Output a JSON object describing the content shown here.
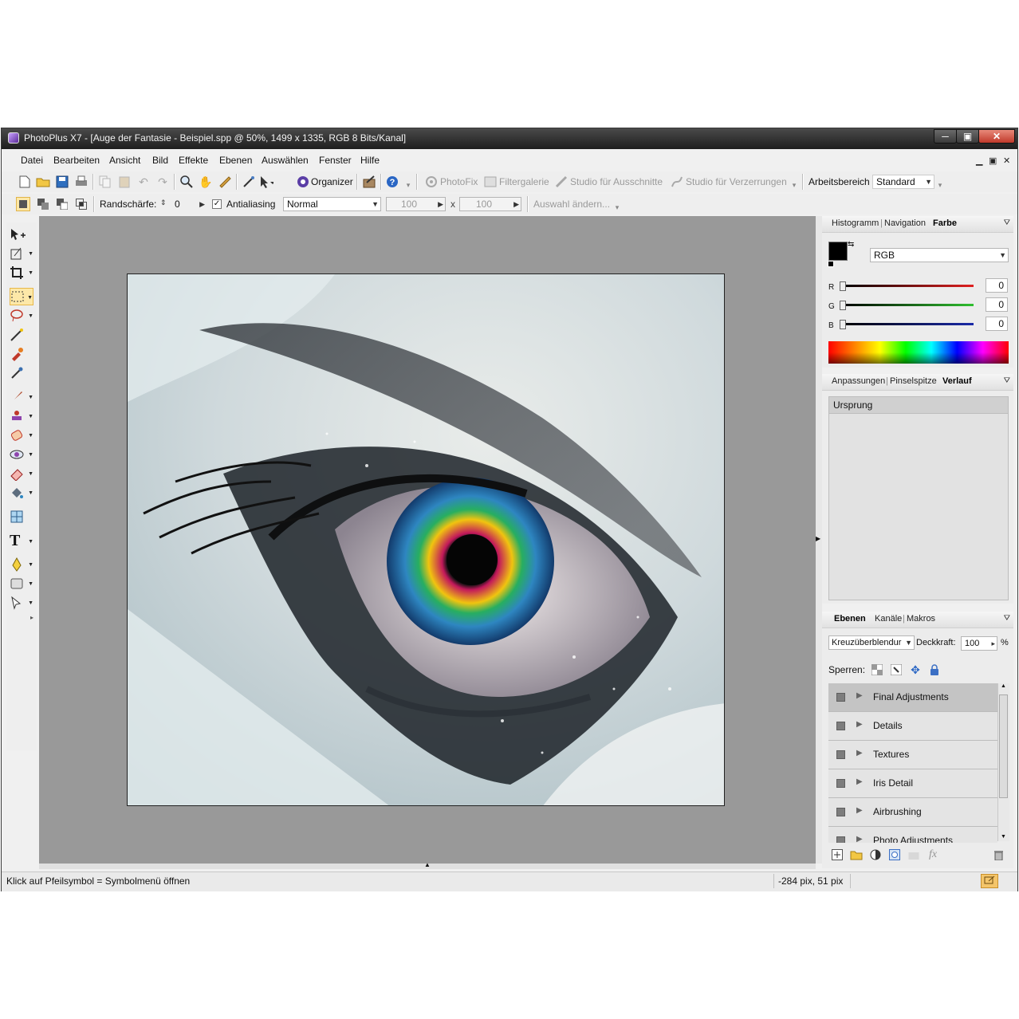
{
  "window": {
    "title": "PhotoPlus X7 - [Auge der Fantasie - Beispiel.spp @ 50%, 1499 x 1335, RGB 8 Bits/Kanal]",
    "minimize": "─",
    "maximize": "▣",
    "close": "✕"
  },
  "menu": [
    "Datei",
    "Bearbeiten",
    "Ansicht",
    "Bild",
    "Effekte",
    "Ebenen",
    "Auswählen",
    "Fenster",
    "Hilfe"
  ],
  "mdi_controls": {
    "minimize": "▁",
    "restore": "▣",
    "close": "✕"
  },
  "toolbar1": {
    "organizer": "Organizer",
    "photofix": "PhotoFix",
    "filtergalerie": "Filtergalerie",
    "studio_ausschnitte": "Studio für Ausschnitte",
    "studio_verzerrungen": "Studio für Verzerrungen",
    "arbeitsbereich_label": "Arbeitsbereich",
    "arbeitsbereich_value": "Standard"
  },
  "toolbar2": {
    "randschaerfe_label": "Randschärfe:",
    "randschaerfe_value": "0",
    "antialiasing_label": "Antialiasing",
    "antialiasing_checked": true,
    "mode_value": "Normal",
    "width_value": "100",
    "x_label": "x",
    "height_value": "100",
    "auswahl_aendern": "Auswahl ändern..."
  },
  "color_panel": {
    "tabs": [
      "Histogramm",
      "Navigation",
      "Farbe"
    ],
    "active_tab": "Farbe",
    "mode": "RGB",
    "channels": [
      {
        "label": "R",
        "value": "0",
        "color": "#d42020"
      },
      {
        "label": "G",
        "value": "0",
        "color": "#2fbf2f"
      },
      {
        "label": "B",
        "value": "0",
        "color": "#1a2aa8"
      }
    ]
  },
  "history_panel": {
    "tabs": [
      "Anpassungen",
      "Pinselspitze",
      "Verlauf"
    ],
    "active_tab": "Verlauf",
    "items": [
      "Ursprung"
    ]
  },
  "layers_panel": {
    "tabs": [
      "Ebenen",
      "Kanäle",
      "Makros"
    ],
    "active_tab": "Ebenen",
    "blend_mode": "Kreuzüberblendur",
    "opacity_label": "Deckkraft:",
    "opacity_value": "100",
    "opacity_unit": "%",
    "lock_label": "Sperren:",
    "layers": [
      "Final Adjustments",
      "Details",
      "Textures",
      "Iris Detail",
      "Airbrushing",
      "Photo Adjustments"
    ],
    "active_layer": "Final Adjustments"
  },
  "status": {
    "hint": "Klick auf Pfeilsymbol = Symbolmenü öffnen",
    "coords": "-284 pix, 51 pix"
  },
  "colors": {
    "selection_highlight": "#fde8a8",
    "canvas_bg": "#999999",
    "titlebar": "#2a2a2a"
  }
}
